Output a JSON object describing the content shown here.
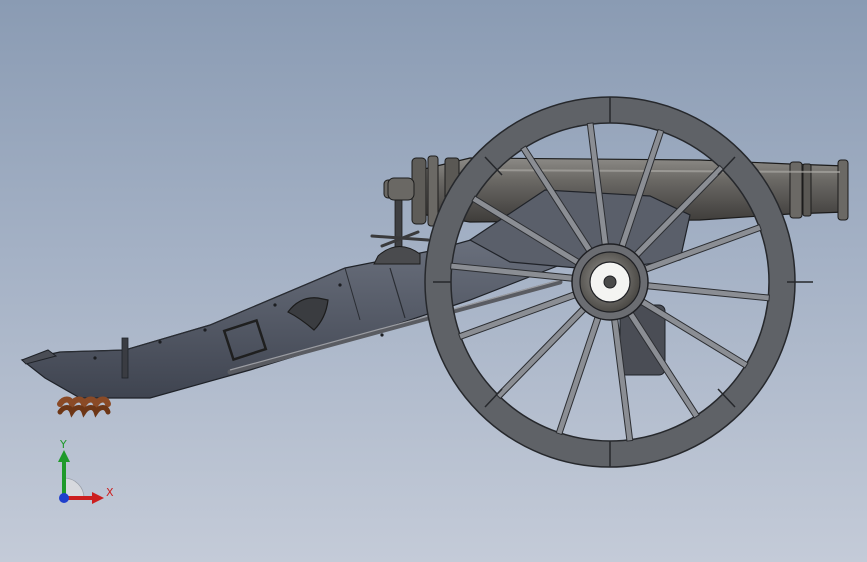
{
  "viewport": {
    "background_top": "#8a9bb3",
    "background_bottom": "#c4cbd8"
  },
  "model": {
    "parts": [
      "cannon-barrel",
      "carriage-trail",
      "wheel",
      "elevating-screw",
      "sponge-rammer",
      "trail-spring"
    ]
  },
  "triad": {
    "x_label": "X",
    "y_label": "Y",
    "x_color": "#cc1f1f",
    "y_color": "#1f9a2a",
    "z_color": "#1f3fcc"
  }
}
